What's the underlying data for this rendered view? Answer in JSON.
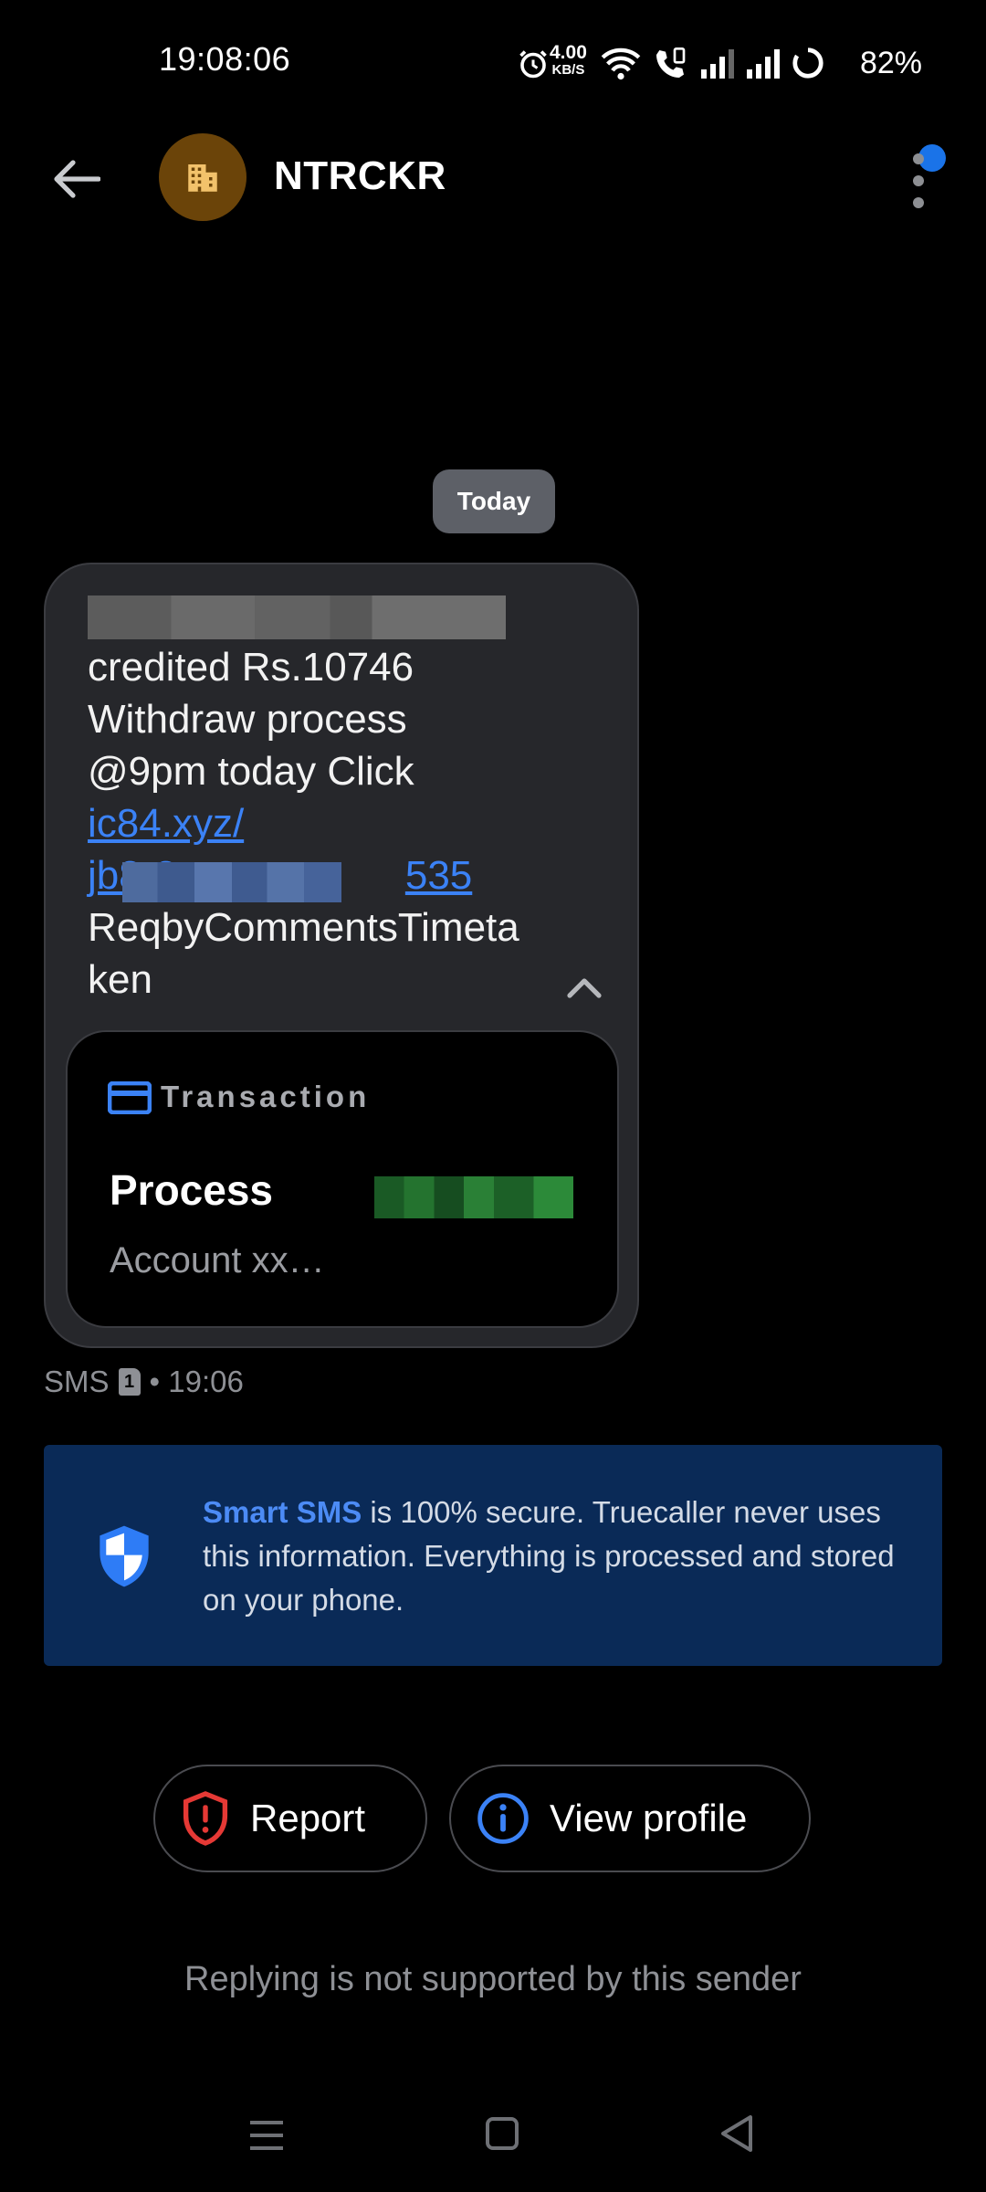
{
  "status_bar": {
    "time": "19:08:06",
    "speed_value": "4.00",
    "speed_unit": "KB/S",
    "battery": "82%"
  },
  "header": {
    "sender": "NTRCKR",
    "avatar_icon": "building-icon",
    "back_icon": "arrow-left-icon",
    "menu_icon": "more-vert-icon"
  },
  "date_chip": "Today",
  "message": {
    "lines": [
      "credited Rs.10746",
      "Withdraw process",
      "@9pm today Click"
    ],
    "link_line_1": "ic84.xyz/",
    "link_line_2_prefix": "jb8-8",
    "link_line_2_suffix": "535",
    "tail_line_1": "ReqbyCommentsTimeta",
    "tail_line_2": "ken"
  },
  "transaction_card": {
    "label": "Transaction",
    "title": "Process",
    "subtitle": "Account xx…"
  },
  "meta": {
    "channel": "SMS",
    "sim": "1",
    "time": "• 19:06"
  },
  "banner": {
    "brand": "Smart SMS",
    "text": " is 100% secure. Truecaller never uses this information. Everything is processed and stored on your phone."
  },
  "actions": {
    "report": "Report",
    "view_profile": "View profile"
  },
  "reply_note": "Replying is not supported by this sender",
  "colors": {
    "accent": "#3b82f6",
    "report_red": "#e53935",
    "banner_bg": "#0a2a57"
  }
}
